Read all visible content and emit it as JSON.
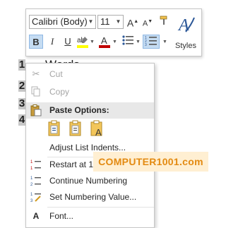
{
  "document": {
    "numbers": [
      "1",
      "2",
      "3",
      "4"
    ],
    "word": "Words"
  },
  "mini_toolbar": {
    "font_name": "Calibri (Body)",
    "font_size": "11",
    "grow_font_icon": "A",
    "shrink_font_icon": "A",
    "bold_label": "B",
    "italic_label": "I",
    "underline_label": "U",
    "styles_label": "Styles",
    "highlight_color": "#ffff00",
    "font_color": "#c00000"
  },
  "context_menu": {
    "items": {
      "cut": "Cut",
      "copy": "Copy",
      "paste_options": "Paste Options:",
      "adjust_list_indents": "Adjust List Indents...",
      "restart_at_1": "Restart at 1",
      "continue_numbering": "Continue Numbering",
      "set_numbering_value": "Set Numbering Value...",
      "font": "Font..."
    },
    "paste_option_icons": [
      "paste-keep-formatting-icon",
      "paste-merge-formatting-icon",
      "paste-keep-text-only-icon"
    ]
  },
  "watermark": "COMPUTER1001.com"
}
